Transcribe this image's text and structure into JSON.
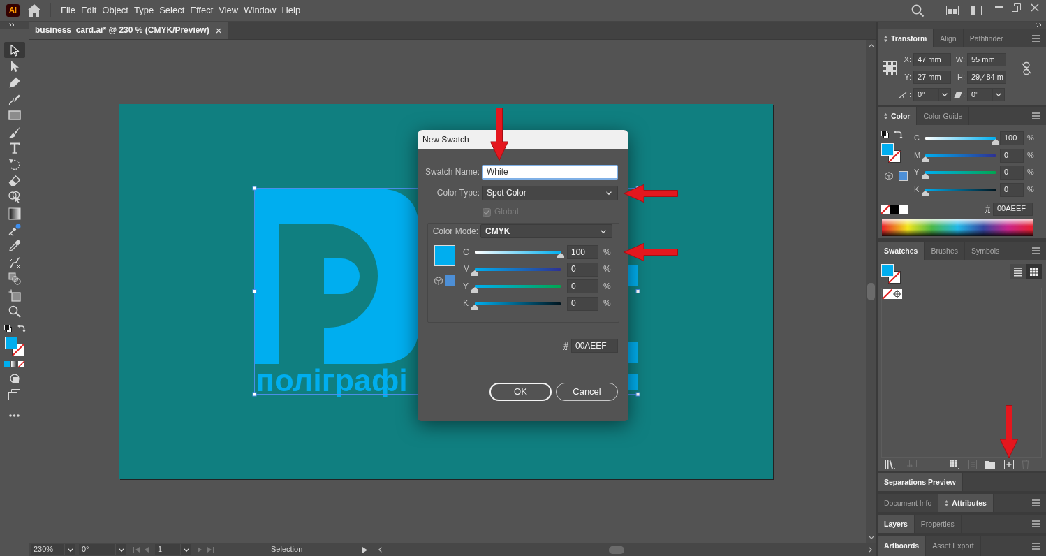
{
  "app_bar": {
    "logo": "Ai",
    "menu": [
      "File",
      "Edit",
      "Object",
      "Type",
      "Select",
      "Effect",
      "View",
      "Window",
      "Help"
    ]
  },
  "document_tab": {
    "title": "business_card.ai* @ 230 % (CMYK/Preview)",
    "close": "×",
    "selected": true
  },
  "tools": [
    {
      "selected": true
    },
    {
      "selected": false
    },
    {
      "selected": false
    },
    {
      "selected": false
    },
    {
      "selected": false
    },
    {
      "selected": false
    },
    {
      "selected": false
    },
    {
      "selected": false
    },
    {
      "selected": false
    },
    {
      "selected": false
    },
    {
      "selected": false
    },
    {
      "selected": false
    },
    {
      "selected": false
    },
    {
      "selected": false
    },
    {
      "selected": false
    },
    {
      "selected": false
    },
    {
      "selected": false
    }
  ],
  "artwork": {
    "text": "поліграфі",
    "selected": true
  },
  "dialog": {
    "title": "New Swatch",
    "swatch_name": {
      "label": "Swatch Name:",
      "value": "White",
      "focused": true,
      "callout_arrow": true
    },
    "color_type": {
      "label": "Color Type:",
      "value": "Spot Color",
      "callout_arrow": true
    },
    "global": {
      "label": "Global",
      "checked": true,
      "disabled": true
    },
    "color_mode": {
      "label": "Color Mode:",
      "value": "CMYK"
    },
    "channels": [
      {
        "name": "C",
        "level": 1,
        "value": "100",
        "unit": "%",
        "callout_arrow": true
      },
      {
        "name": "M",
        "level": 0,
        "value": "0",
        "unit": "%"
      },
      {
        "name": "Y",
        "level": 0,
        "value": "0",
        "unit": "%"
      },
      {
        "name": "K",
        "level": 0,
        "value": "0",
        "unit": "%"
      }
    ],
    "hex": {
      "label": "#",
      "value": "00AEEF"
    },
    "buttons": [
      {
        "label": "OK",
        "default": true
      },
      {
        "label": "Cancel",
        "default": false
      }
    ]
  },
  "panels": [
    {
      "kind": "transform",
      "menu_icon": true,
      "tabs": [
        {
          "label": "Transform",
          "selected": true,
          "options_icon": true
        },
        {
          "label": "Align",
          "selected": false,
          "options_icon": false
        },
        {
          "label": "Pathfinder",
          "selected": false,
          "options_icon": false
        }
      ],
      "fields": [
        {
          "label": "X:",
          "value": "47 mm"
        },
        {
          "label": "W:",
          "value": "55 mm"
        },
        {
          "label": "Y:",
          "value": "27 mm"
        },
        {
          "label": "H:",
          "value": "29,484 m"
        }
      ],
      "angles": [
        {
          "label": ":",
          "value": "0°"
        },
        {
          "label": ":",
          "value": "0°"
        }
      ]
    },
    {
      "kind": "color",
      "menu_icon": true,
      "tabs": [
        {
          "label": "Color",
          "selected": true,
          "options_icon": true
        },
        {
          "label": "Color Guide",
          "selected": false,
          "options_icon": false
        }
      ],
      "channels": [
        {
          "name": "C",
          "level": 1,
          "value": "100",
          "unit": "%"
        },
        {
          "name": "M",
          "level": 0,
          "value": "0",
          "unit": "%"
        },
        {
          "name": "Y",
          "level": 0,
          "value": "0",
          "unit": "%"
        },
        {
          "name": "K",
          "level": 0,
          "value": "0",
          "unit": "%"
        }
      ],
      "hex": {
        "label": "#",
        "value": "00AEEF"
      }
    },
    {
      "kind": "swatches",
      "menu_icon": true,
      "tabs": [
        {
          "label": "Swatches",
          "selected": true,
          "options_icon": false
        },
        {
          "label": "Brushes",
          "selected": false,
          "options_icon": false
        },
        {
          "label": "Symbols",
          "selected": false,
          "options_icon": false
        }
      ],
      "view_buttons": [
        {
          "selected": false
        },
        {
          "selected": true
        }
      ],
      "new_swatch_button": {
        "callout_arrow": true
      }
    },
    {
      "kind": "collapsed",
      "menu_icon": false,
      "tabs": [
        {
          "label": "Separations Preview",
          "selected": true,
          "options_icon": false
        }
      ]
    },
    {
      "kind": "collapsed",
      "menu_icon": true,
      "tabs": [
        {
          "label": "Document Info",
          "selected": false,
          "options_icon": false
        },
        {
          "label": "Attributes",
          "selected": true,
          "options_icon": true
        }
      ]
    },
    {
      "kind": "collapsed",
      "menu_icon": true,
      "tabs": [
        {
          "label": "Layers",
          "selected": true,
          "options_icon": false
        },
        {
          "label": "Properties",
          "selected": false,
          "options_icon": false
        }
      ]
    },
    {
      "kind": "collapsed",
      "menu_icon": true,
      "tabs": [
        {
          "label": "Artboards",
          "selected": true,
          "options_icon": false
        },
        {
          "label": "Asset Export",
          "selected": false,
          "options_icon": false
        }
      ]
    }
  ],
  "status_bar": {
    "zoom": "230%",
    "rotation": "0°",
    "artboard": "1",
    "tool": "Selection"
  }
}
